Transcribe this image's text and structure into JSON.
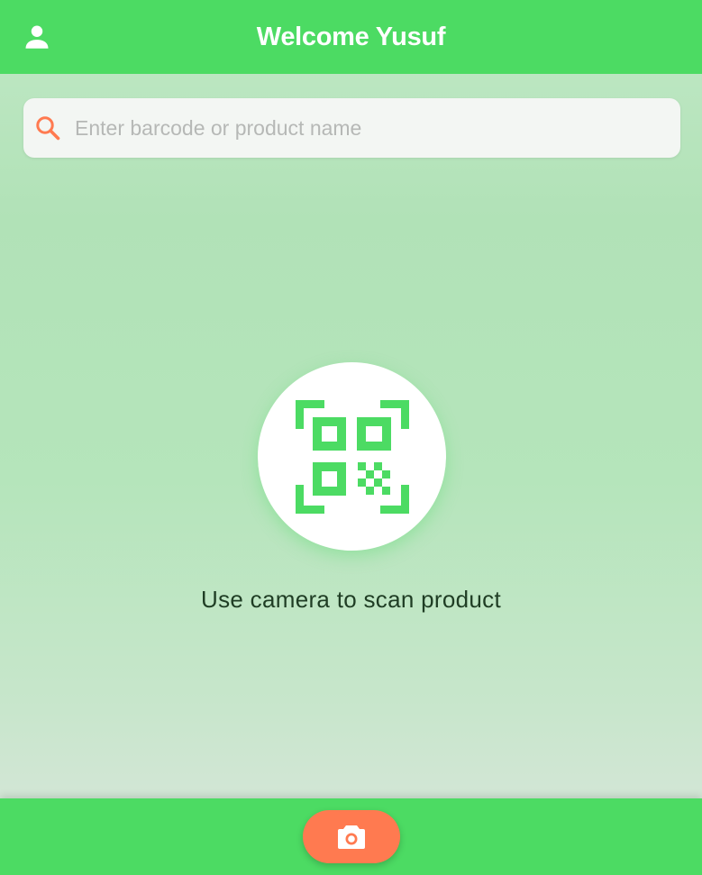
{
  "header": {
    "title": "Welcome Yusuf",
    "profile_icon": "person-icon"
  },
  "search": {
    "placeholder": "Enter barcode or product name",
    "value": "",
    "icon": "search-icon"
  },
  "scanner": {
    "icon": "qr-code-scan-icon",
    "caption": "Use camera to scan product"
  },
  "bottom_bar": {
    "camera_icon": "camera-icon"
  },
  "colors": {
    "primary": "#4cdb63",
    "accent": "#ff7a50",
    "search_bg": "#f3f6f3"
  }
}
